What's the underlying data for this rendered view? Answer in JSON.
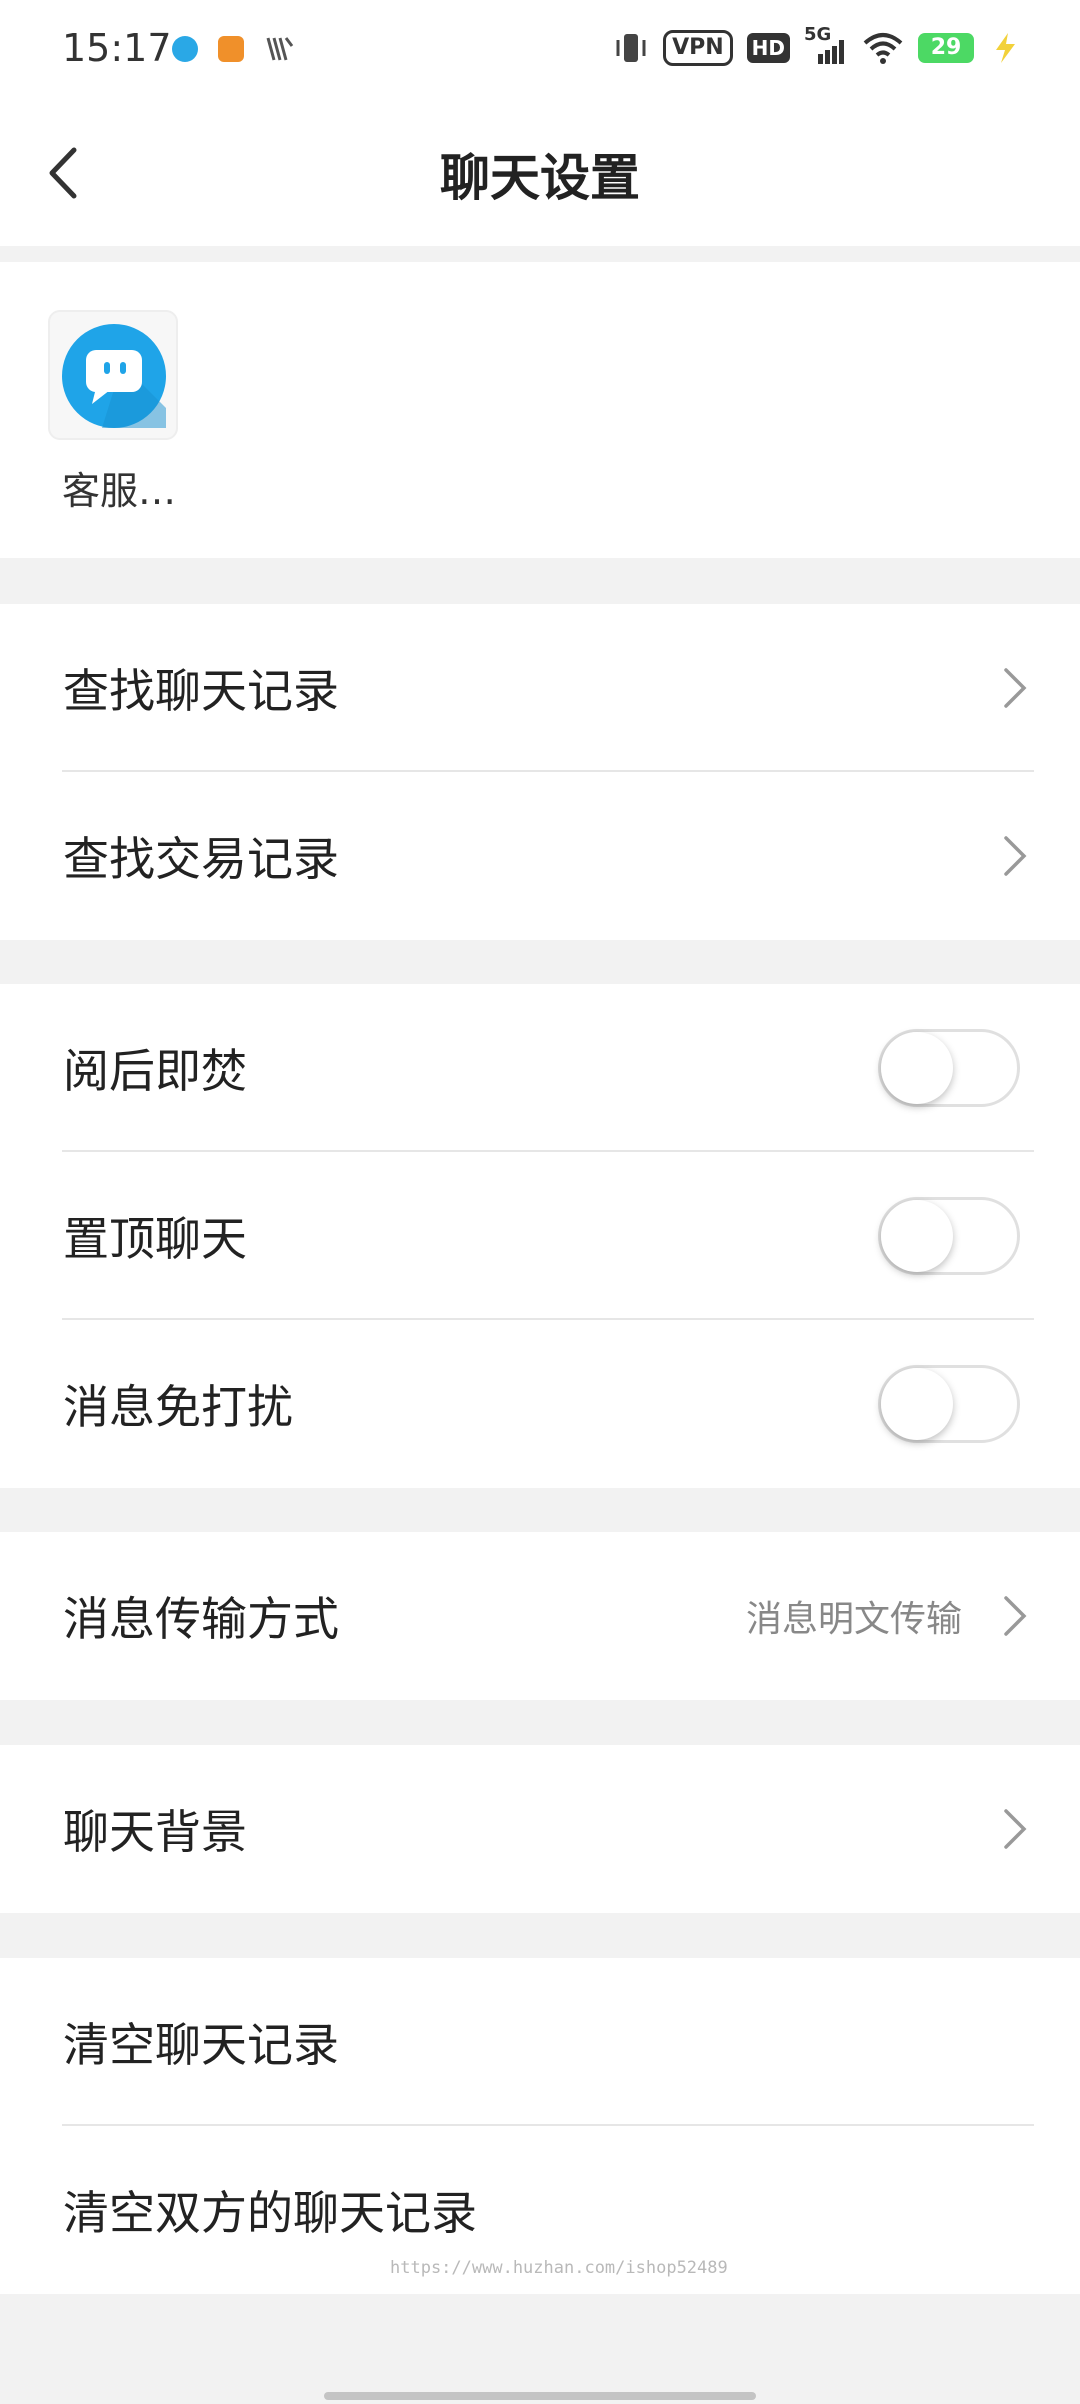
{
  "status_bar": {
    "time": "15:17",
    "vpn": "VPN",
    "hd": "HD",
    "network": "5G",
    "battery": "29",
    "icons": [
      "vibrate-icon",
      "signal-icon",
      "wifi-icon",
      "charging-icon"
    ]
  },
  "header": {
    "title": "聊天设置",
    "back_icon": "back-chevron-icon"
  },
  "contact": {
    "name": "客服…",
    "avatar_color": "#1fa4e8"
  },
  "search_section": {
    "items": [
      {
        "label": "查找聊天记录"
      },
      {
        "label": "查找交易记录"
      }
    ]
  },
  "toggles_section": {
    "items": [
      {
        "label": "阅后即焚",
        "enabled": false
      },
      {
        "label": "置顶聊天",
        "enabled": false
      },
      {
        "label": "消息免打扰",
        "enabled": false
      }
    ]
  },
  "transfer_section": {
    "label": "消息传输方式",
    "value": "消息明文传输"
  },
  "background_section": {
    "label": "聊天背景"
  },
  "clear_section": {
    "items": [
      {
        "label": "清空聊天记录"
      },
      {
        "label": "清空双方的聊天记录"
      }
    ]
  },
  "watermark": "https://www.huzhan.com/ishop52489"
}
